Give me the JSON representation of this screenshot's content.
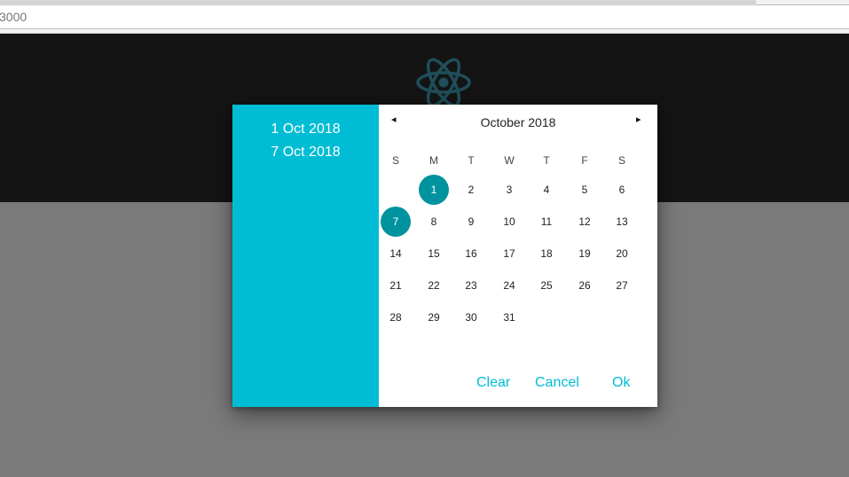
{
  "browser": {
    "url": "3000"
  },
  "dialog": {
    "selected_start": "1 Oct 2018",
    "selected_end": "7 Oct 2018",
    "month_title": "October 2018",
    "prev_icon": "◂",
    "next_icon": "▸",
    "weekdays": [
      "S",
      "M",
      "T",
      "W",
      "T",
      "F",
      "S"
    ],
    "weeks": [
      [
        "",
        "1",
        "2",
        "3",
        "4",
        "5",
        "6"
      ],
      [
        "7",
        "8",
        "9",
        "10",
        "11",
        "12",
        "13"
      ],
      [
        "14",
        "15",
        "16",
        "17",
        "18",
        "19",
        "20"
      ],
      [
        "21",
        "22",
        "23",
        "24",
        "25",
        "26",
        "27"
      ],
      [
        "28",
        "29",
        "30",
        "31",
        "",
        "",
        ""
      ]
    ],
    "selected_days": [
      "1",
      "7"
    ],
    "buttons": {
      "clear": "Clear",
      "cancel": "Cancel",
      "ok": "Ok"
    }
  },
  "colors": {
    "accent": "#00bcd4",
    "selected": "#00939f",
    "header_bg": "#141414",
    "backdrop": "#7a7a7a"
  },
  "icons": {
    "logo": "react-atom-logo"
  }
}
